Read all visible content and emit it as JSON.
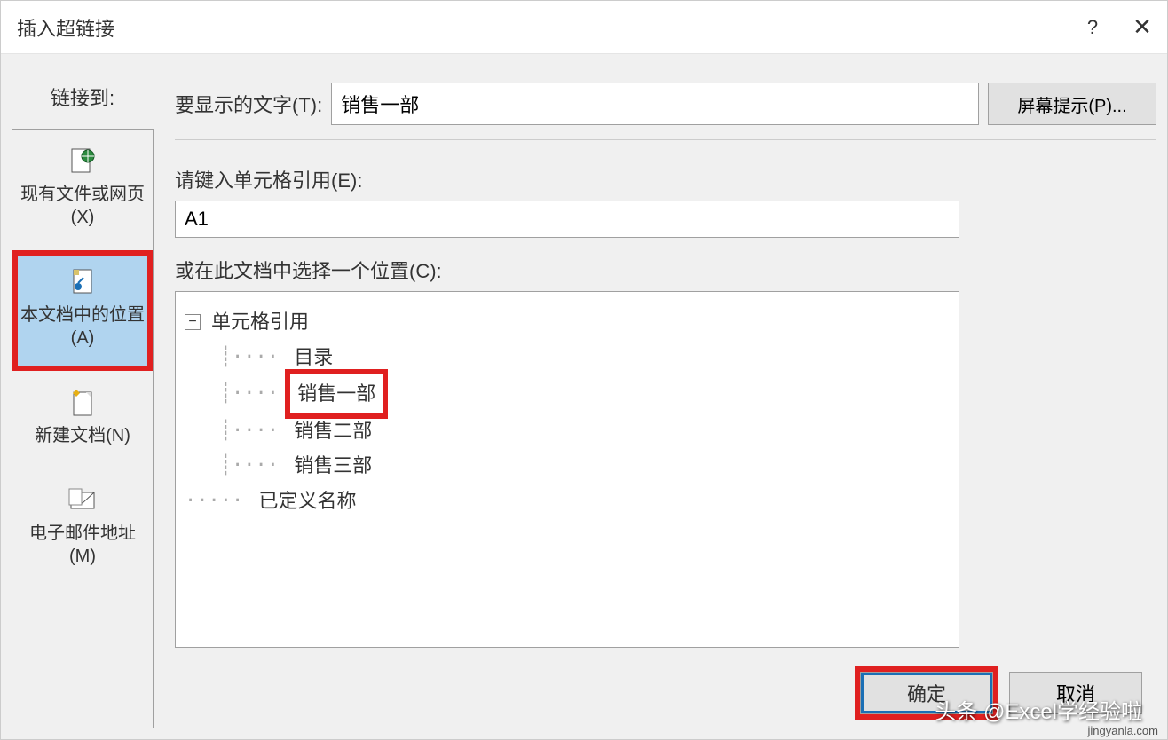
{
  "titlebar": {
    "title": "插入超链接",
    "help": "?",
    "close": "✕"
  },
  "left": {
    "link_to_label": "链接到:",
    "targets": [
      {
        "label": "现有文件或网页(X)",
        "icon": "globe-document"
      },
      {
        "label": "本文档中的位置(A)",
        "icon": "document-anchor",
        "selected": true,
        "highlighted": true
      },
      {
        "label": "新建文档(N)",
        "icon": "new-document"
      },
      {
        "label": "电子邮件地址(M)",
        "icon": "email"
      }
    ]
  },
  "main": {
    "display_text_label": "要显示的文字(T):",
    "display_text_value": "销售一部",
    "screen_tip_label": "屏幕提示(P)...",
    "cell_ref_label": "请键入单元格引用(E):",
    "cell_ref_value": "A1",
    "doc_select_label": "或在此文档中选择一个位置(C):",
    "tree": {
      "root1": "单元格引用",
      "children": [
        {
          "label": "目录"
        },
        {
          "label": "销售一部",
          "highlighted": true
        },
        {
          "label": "销售二部"
        },
        {
          "label": "销售三部"
        }
      ],
      "root2": "已定义名称"
    }
  },
  "buttons": {
    "ok": "确定",
    "cancel": "取消"
  },
  "watermark": {
    "main": "头条 @Excel学经验啦",
    "sub": "jingyanla.com"
  }
}
